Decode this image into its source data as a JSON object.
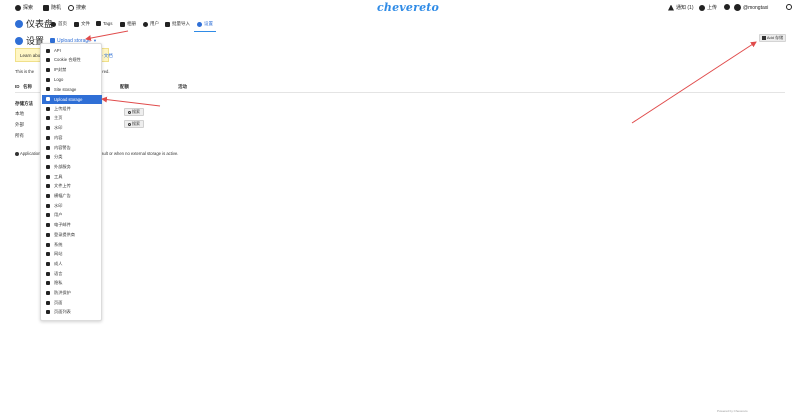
{
  "topbar": {
    "left": [
      {
        "label": "探索",
        "icon": "compass-icon"
      },
      {
        "label": "随机",
        "icon": "shuffle-icon"
      },
      {
        "label": "搜索",
        "icon": "search-icon"
      }
    ],
    "logo": "chevereto",
    "right": {
      "notices": "通知 (1)",
      "upload": "上传",
      "username": "@mongtaxi"
    }
  },
  "nav": {
    "dashboard_title": "仪表盘",
    "items": [
      {
        "label": "首页",
        "icon": "home-icon"
      },
      {
        "label": "文件",
        "icon": "images-icon"
      },
      {
        "label": "Tags",
        "icon": "tag-icon"
      },
      {
        "label": "相册",
        "icon": "album-icon"
      },
      {
        "label": "用户",
        "icon": "users-icon"
      },
      {
        "label": "批量导入",
        "icon": "import-icon"
      },
      {
        "label": "设置",
        "icon": "gear-icon"
      }
    ]
  },
  "settings": {
    "title": "设置",
    "current_section": "Upload storage"
  },
  "notice": {
    "text_left": "Learn abou",
    "text_right": "e 文档"
  },
  "info": {
    "left": "This is the",
    "right": "ored."
  },
  "table": {
    "headers": [
      "ID",
      "名称",
      "配额",
      "活动"
    ],
    "section": "存储方法",
    "rows": [
      "本地",
      "外部",
      "所有"
    ],
    "search_button": "搜索"
  },
  "application_note": {
    "left": "Application",
    "right": "fault or when no external storage is active."
  },
  "add_button": "Add 存储",
  "dropdown": {
    "items": [
      {
        "label": "API",
        "icon": "api-icon",
        "selected": false
      },
      {
        "label": "Cookie 合规性",
        "icon": "cookie-icon",
        "selected": false
      },
      {
        "label": "IP封禁",
        "icon": "ban-icon",
        "selected": false
      },
      {
        "label": "Logo",
        "icon": "palette-icon",
        "selected": false
      },
      {
        "label": "Site storage",
        "icon": "hdd-icon",
        "selected": false
      },
      {
        "label": "Upload storage",
        "icon": "hdd-icon",
        "selected": true
      },
      {
        "label": "上传组件",
        "icon": "cloud-upload-icon",
        "selected": false
      },
      {
        "label": "主页",
        "icon": "home-icon",
        "selected": false
      },
      {
        "label": "水印",
        "icon": "watermark-icon",
        "selected": false
      },
      {
        "label": "内容",
        "icon": "file-icon",
        "selected": false
      },
      {
        "label": "内容警告",
        "icon": "monitor-icon",
        "selected": false
      },
      {
        "label": "分类",
        "icon": "columns-icon",
        "selected": false
      },
      {
        "label": "外部服务",
        "icon": "triangle-icon",
        "selected": false
      },
      {
        "label": "工具",
        "icon": "tools-icon",
        "selected": false
      },
      {
        "label": "文件上传",
        "icon": "cloud-icon",
        "selected": false
      },
      {
        "label": "横幅广告",
        "icon": "bullhorn-icon",
        "selected": false
      },
      {
        "label": "水印",
        "icon": "tint-icon",
        "selected": false
      },
      {
        "label": "用户",
        "icon": "users-icon",
        "selected": false
      },
      {
        "label": "电子邮件",
        "icon": "at-icon",
        "selected": false
      },
      {
        "label": "登录提供商",
        "icon": "sign-in-icon",
        "selected": false
      },
      {
        "label": "系统",
        "icon": "server-icon",
        "selected": false
      },
      {
        "label": "网站",
        "icon": "globe-icon",
        "selected": false
      },
      {
        "label": "成人",
        "icon": "flag-icon",
        "selected": false
      },
      {
        "label": "语言",
        "icon": "language-icon",
        "selected": false
      },
      {
        "label": "隐私",
        "icon": "lock-icon",
        "selected": false
      },
      {
        "label": "防洪保护",
        "icon": "water-icon",
        "selected": false
      },
      {
        "label": "页面",
        "icon": "page-icon",
        "selected": false
      },
      {
        "label": "页面列表",
        "icon": "list-icon",
        "selected": false
      }
    ]
  },
  "footer": "Powered by Chevereto"
}
